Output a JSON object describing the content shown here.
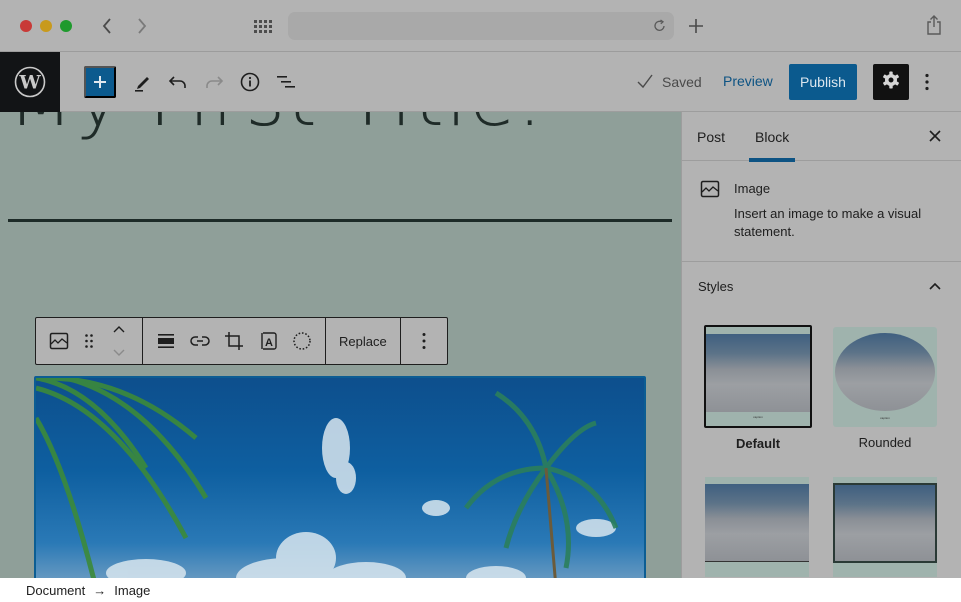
{
  "browser": {
    "icons": [
      "close-window",
      "minimize-window",
      "maximize-window",
      "back-arrow",
      "forward-arrow",
      "tab-grid",
      "reload",
      "new-tab",
      "share"
    ]
  },
  "toolbar": {
    "add_block_label": "+",
    "saved_label": "Saved",
    "preview_label": "Preview",
    "publish_label": "Publish",
    "accent_color": "#0b5a8e"
  },
  "editor": {
    "post_title": "My First Title."
  },
  "block_toolbar": {
    "replace_label": "Replace"
  },
  "sidebar": {
    "tabs": [
      {
        "label": "Post",
        "active": false
      },
      {
        "label": "Block",
        "active": true
      }
    ],
    "block": {
      "name": "Image",
      "description": "Insert an image to make a visual statement."
    },
    "styles": {
      "heading": "Styles",
      "options": [
        {
          "label": "Default",
          "selected": true
        },
        {
          "label": "Rounded",
          "selected": false
        },
        {
          "label": "",
          "selected": false
        },
        {
          "label": "",
          "selected": false
        }
      ]
    }
  },
  "breadcrumb": {
    "items": [
      "Document",
      "Image"
    ],
    "separator": "→"
  }
}
